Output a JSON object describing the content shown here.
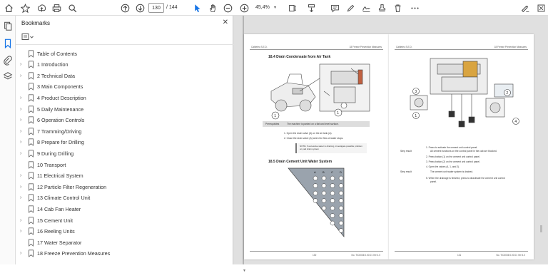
{
  "toolbar": {
    "page_current": "130",
    "page_total": "/ 144",
    "zoom": "45,4%",
    "icons": [
      "home-icon",
      "bookmark-star-icon",
      "upload-icon",
      "print-icon",
      "search-icon",
      "page-up-icon",
      "page-down-icon",
      "select-icon",
      "hand-icon",
      "zoom-out-icon",
      "zoom-in-icon",
      "fit-icon",
      "scroll-icon",
      "comment-icon",
      "pen-icon",
      "signature-icon",
      "stamp-icon",
      "delete-icon",
      "more-icon",
      "share-icon",
      "sign-icon"
    ]
  },
  "panel": {
    "title": "Bookmarks",
    "bookmarks": [
      {
        "label": "Table of Contents",
        "expandable": false
      },
      {
        "label": "1 Introduction",
        "expandable": true
      },
      {
        "label": "2 Technical Data",
        "expandable": true
      },
      {
        "label": "3 Main Components",
        "expandable": false
      },
      {
        "label": "4 Product Description",
        "expandable": true
      },
      {
        "label": "5 Daily Maintenance",
        "expandable": true
      },
      {
        "label": "6 Operation Controls",
        "expandable": true
      },
      {
        "label": "7 Tramming/Driving",
        "expandable": true
      },
      {
        "label": "8 Prepare for Drilling",
        "expandable": true
      },
      {
        "label": "9 During Drilling",
        "expandable": true
      },
      {
        "label": "10 Transport",
        "expandable": false
      },
      {
        "label": "11 Electrical System",
        "expandable": true
      },
      {
        "label": "12 Particle Filter Regeneration",
        "expandable": true
      },
      {
        "label": "13 Climate Control Unit",
        "expandable": true
      },
      {
        "label": "14 Cab Fan Heater",
        "expandable": false
      },
      {
        "label": "15 Cement Unit",
        "expandable": true
      },
      {
        "label": "16 Reeling Units",
        "expandable": true
      },
      {
        "label": "17 Water Separator",
        "expandable": false
      },
      {
        "label": "18 Freeze Prevention Measures",
        "expandable": true
      }
    ]
  },
  "doc": {
    "left_page": {
      "head_left": "Cabletec S.E.D.",
      "head_right": "18 Freeze Prevention Measures",
      "sec1": "18.4  Drain Condensate from Air Tank",
      "prereq_label": "Prerequisites",
      "prereq_text": "The machine is parked on a flat and level surface.",
      "step1": "1.   Open the drain valve (A) on the air tank (A).",
      "step2": "2.   Close the drain valve (A) when the flow of water stops.",
      "note": "NOTE: If excessive water is draining, investigate possible problem on pad drain system",
      "sec2": "18.5  Drain Cement Unit Water System",
      "grid_cols": [
        "A",
        "B",
        "C",
        "D"
      ],
      "foot_left": "130",
      "foot_right": "No. TIC0036 0.00.01 Ver 4.0"
    },
    "right_page": {
      "head_left": "Cabletec S.E.D.",
      "head_right": "18 Freeze Prevention Measures",
      "step_result1": "Step result",
      "step1": "1.   Press      to activate the cement unit control panel.",
      "step1b": "All cement functions on the control panel in the cab are blocked.",
      "step2": "2.   Press button (1) on the cement unit control panel.",
      "step3": "3.   Press button (2) on the cement unit control panel.",
      "step4": "4.   Open the valves (4, 1, and 2).",
      "step_result2": "Step result",
      "step4b": "The cement unit water system is drained.",
      "step5": "5.   When the drainage is finished, press      to deactivate the cement unit control",
      "step5b": "panel.",
      "foot_left": "131",
      "foot_right": "No. TIC0036 0.00.01 Ver 4.0"
    }
  }
}
